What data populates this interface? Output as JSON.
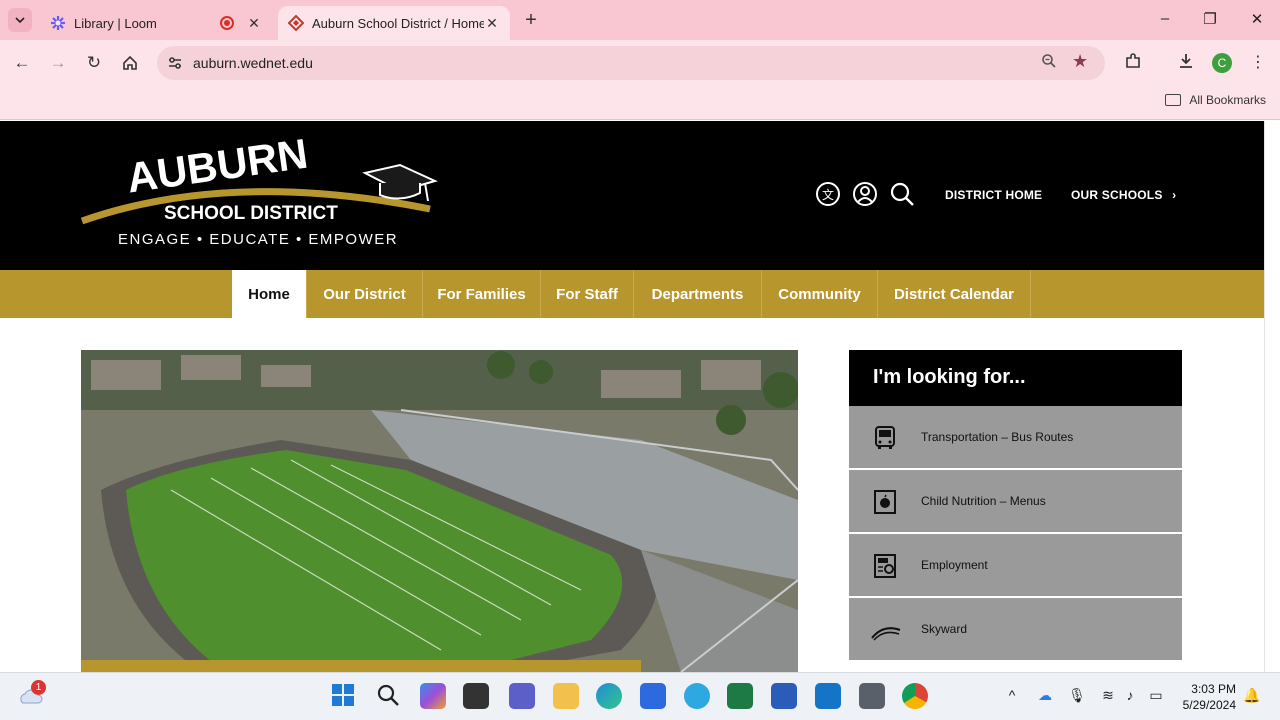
{
  "browser": {
    "tabs": [
      {
        "title": "Library | Loom"
      },
      {
        "title": "Auburn School District / Homep"
      }
    ],
    "url": "auburn.wednet.edu",
    "bookmarks_label": "All Bookmarks",
    "profile_initial": "C"
  },
  "site": {
    "logo": {
      "name": "AUBURN",
      "subtitle": "SCHOOL DISTRICT",
      "tagline": "ENGAGE • EDUCATE • EMPOWER"
    },
    "header_links": {
      "district_home": "DISTRICT HOME",
      "our_schools": "OUR SCHOOLS"
    },
    "nav": [
      {
        "label": "Home"
      },
      {
        "label": "Our District"
      },
      {
        "label": "For Families"
      },
      {
        "label": "For Staff"
      },
      {
        "label": "Departments"
      },
      {
        "label": "Community"
      },
      {
        "label": "District Calendar"
      }
    ],
    "panel": {
      "title": "I'm looking for...",
      "items": [
        {
          "label": "Transportation – Bus Routes",
          "icon": "bus-icon"
        },
        {
          "label": "Child Nutrition – Menus",
          "icon": "apple-icon"
        },
        {
          "label": "Employment",
          "icon": "jobs-newspaper-icon"
        },
        {
          "label": "Skyward",
          "icon": "skyward-logo-icon"
        }
      ]
    },
    "colors": {
      "gold": "#b8962e",
      "black": "#000000",
      "panel_gray": "#9a9a9a"
    }
  },
  "taskbar": {
    "time": "3:03 PM",
    "date": "5/29/2024",
    "weather_badge": "1"
  }
}
